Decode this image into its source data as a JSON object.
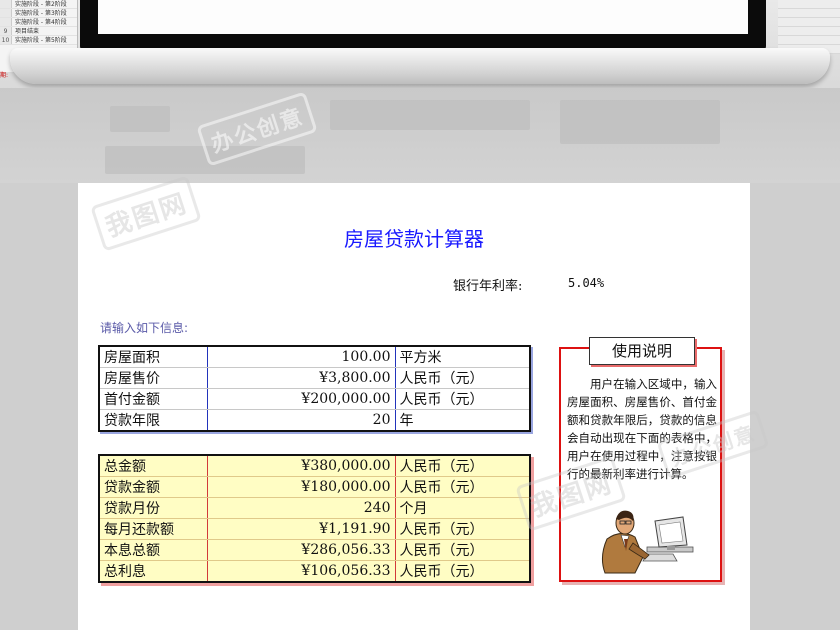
{
  "background_sheet": {
    "rows": [
      {
        "num": "",
        "text": "实施阶段 - 第2阶段"
      },
      {
        "num": "",
        "text": "实施阶段 - 第3阶段"
      },
      {
        "num": "",
        "text": "实施阶段 - 第4阶段"
      },
      {
        "num": "9",
        "text": "项目结束"
      },
      {
        "num": "10",
        "text": "实施阶段 - 第5阶段"
      }
    ],
    "footer_fragment": "期:"
  },
  "watermarks": [
    "我图网",
    "办公创意"
  ],
  "calculator": {
    "title": "房屋贷款计算器",
    "rate_label": "银行年利率:",
    "rate_value": "5.04%",
    "prompt": "请输入如下信息:",
    "inputs": [
      {
        "label": "房屋面积",
        "value": "100.00",
        "unit": "平方米"
      },
      {
        "label": "房屋售价",
        "value": "¥3,800.00",
        "unit": "人民币（元）"
      },
      {
        "label": "首付金额",
        "value": "¥200,000.00",
        "unit": "人民币（元）"
      },
      {
        "label": "贷款年限",
        "value": "20",
        "unit": "年"
      }
    ],
    "outputs": [
      {
        "label": "总金额",
        "value": "¥380,000.00",
        "unit": "人民币（元）"
      },
      {
        "label": "贷款金额",
        "value": "¥180,000.00",
        "unit": "人民币（元）"
      },
      {
        "label": "贷款月份",
        "value": "240",
        "unit": "个月"
      },
      {
        "label": "每月还款额",
        "value": "¥1,191.90",
        "unit": "人民币（元）"
      },
      {
        "label": "本息总额",
        "value": "¥286,056.33",
        "unit": "人民币（元）"
      },
      {
        "label": "总利息",
        "value": "¥106,056.33",
        "unit": "人民币（元）"
      }
    ],
    "help": {
      "title": "使用说明",
      "text": "用户在输入区域中，输入房屋面积、房屋售价、首付金额和贷款年限后，贷款的信息会自动出现在下面的表格中，用户在使用过程中，注意按银行的最新利率进行计算。",
      "clipart_icon": "businessman-at-computer-icon"
    }
  },
  "colors": {
    "title": "#1a1aff",
    "output_fill": "#fffdc4",
    "help_border": "#dd1111",
    "column_divider": "#2233bb"
  }
}
